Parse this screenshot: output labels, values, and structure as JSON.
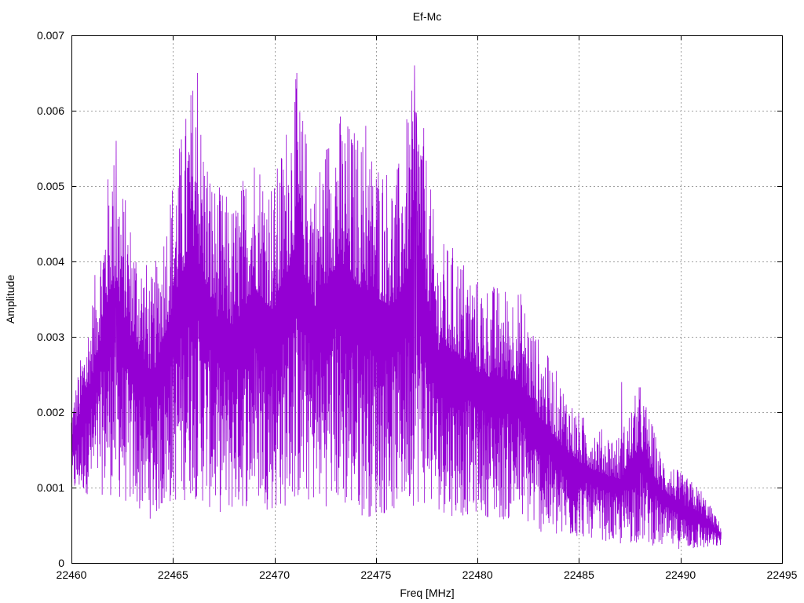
{
  "chart_data": {
    "type": "line",
    "title": "Ef-Mc",
    "xlabel": "Freq [MHz]",
    "ylabel": "Amplitude",
    "xlim": [
      22460,
      22495
    ],
    "ylim": [
      0,
      0.007
    ],
    "xticks": [
      22460,
      22465,
      22470,
      22475,
      22480,
      22485,
      22490,
      22495
    ],
    "yticks": [
      0,
      0.001,
      0.002,
      0.003,
      0.004,
      0.005,
      0.006,
      0.007
    ],
    "ytick_labels": [
      "0",
      "0.001",
      "0.002",
      "0.003",
      "0.004",
      "0.005",
      "0.006",
      "0.007"
    ],
    "grid": true,
    "series": [
      {
        "color": "#9400d3",
        "x_start": 22460,
        "x_end": 22492,
        "envelope_x": [
          22460,
          22461,
          22462,
          22463,
          22464,
          22465,
          22466,
          22467,
          22468,
          22469,
          22470,
          22471,
          22472,
          22473,
          22474,
          22475,
          22476,
          22477,
          22478,
          22479,
          22480,
          22481,
          22482,
          22483,
          22484,
          22485,
          22486,
          22487,
          22488,
          22489,
          22490,
          22491,
          22492
        ],
        "envelope_max": [
          0.0021,
          0.0035,
          0.0056,
          0.0045,
          0.0038,
          0.0052,
          0.0065,
          0.0051,
          0.0048,
          0.0056,
          0.0051,
          0.0065,
          0.0052,
          0.0061,
          0.0058,
          0.0055,
          0.0052,
          0.0066,
          0.0043,
          0.0042,
          0.0038,
          0.0037,
          0.0037,
          0.003,
          0.0025,
          0.002,
          0.0018,
          0.0017,
          0.0024,
          0.0015,
          0.0012,
          0.001,
          0.0005
        ],
        "envelope_min": [
          0.0008,
          0.0007,
          0.0005,
          0.0004,
          0.0003,
          0.0004,
          0.0004,
          0.0003,
          0.0003,
          0.0004,
          0.0003,
          0.0003,
          0.0004,
          0.0003,
          0.0002,
          0.0002,
          0.0003,
          0.0003,
          0.0004,
          0.0003,
          0.0004,
          0.0003,
          0.0003,
          0.0002,
          0.0001,
          0.0002,
          0.0002,
          0.0001,
          0.0001,
          0.0001,
          0.0001,
          0.0001,
          0.0002
        ],
        "peaks": [
          {
            "x": 22462.2,
            "y": 0.0056
          },
          {
            "x": 22466.2,
            "y": 0.0065
          },
          {
            "x": 22471.1,
            "y": 0.0065
          },
          {
            "x": 22474.5,
            "y": 0.0058
          },
          {
            "x": 22476.9,
            "y": 0.0066
          },
          {
            "x": 22477.0,
            "y": 0.0059
          },
          {
            "x": 22487.1,
            "y": 0.0024
          }
        ]
      }
    ]
  }
}
